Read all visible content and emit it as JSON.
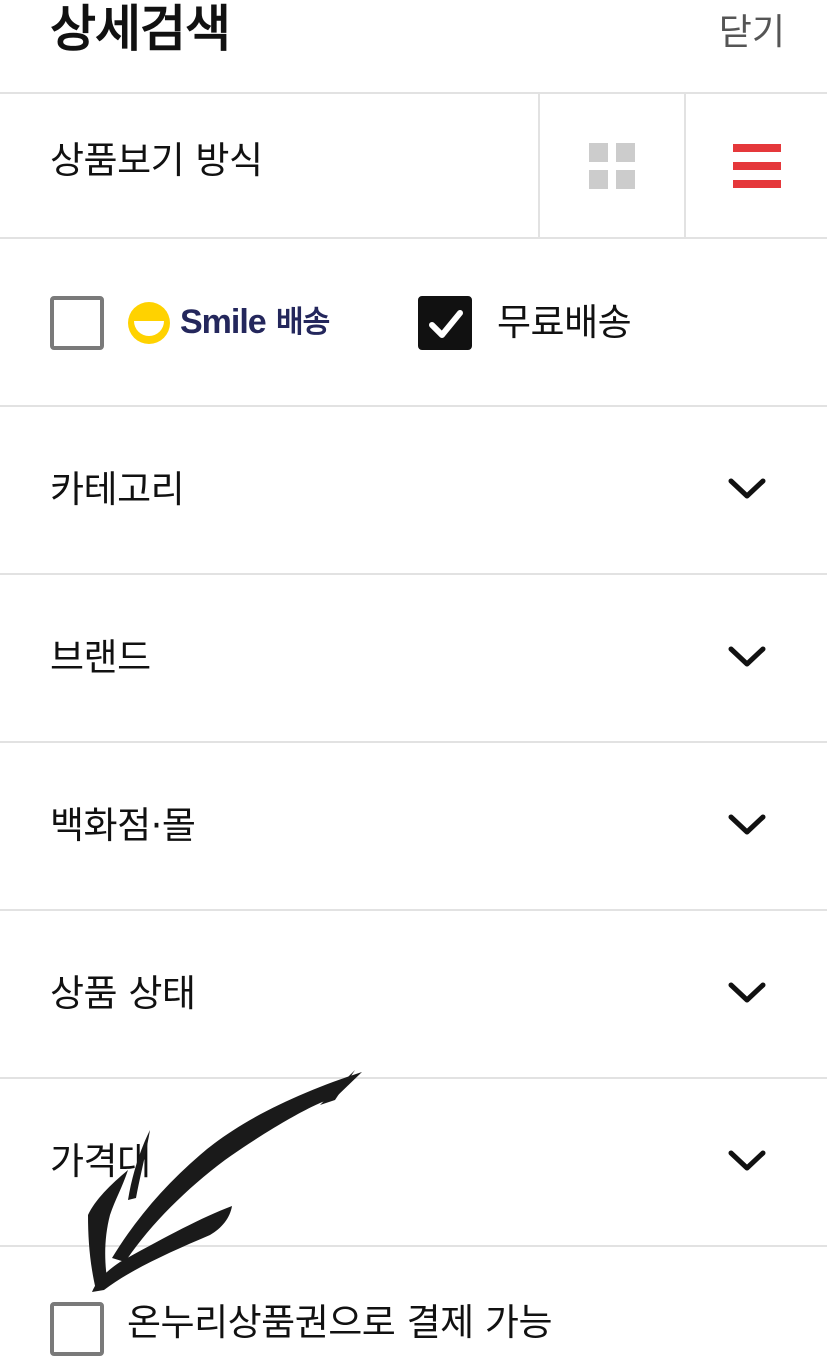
{
  "header": {
    "title": "상세검색",
    "close_label": "닫기"
  },
  "view_mode": {
    "label": "상품보기 방식",
    "options": [
      {
        "name": "grid",
        "icon": "grid-icon",
        "selected": false,
        "color": "#cccccc"
      },
      {
        "name": "list",
        "icon": "list-icon",
        "selected": true,
        "color": "#e5383b"
      }
    ]
  },
  "filters": {
    "smile_delivery": {
      "checked": false,
      "logo_text": "Smile",
      "logo_suffix": "배송",
      "logo_color": "#24275c",
      "smile_icon_color": "#ffd200"
    },
    "free_shipping": {
      "checked": true,
      "label": "무료배송"
    }
  },
  "accordion": [
    {
      "label": "카테고리"
    },
    {
      "label": "브랜드"
    },
    {
      "label": "백화점·몰"
    },
    {
      "label": "상품 상태"
    },
    {
      "label": "가격대"
    }
  ],
  "onnuri": {
    "checked": false,
    "label": "온누리상품권으로 결제 가능"
  }
}
